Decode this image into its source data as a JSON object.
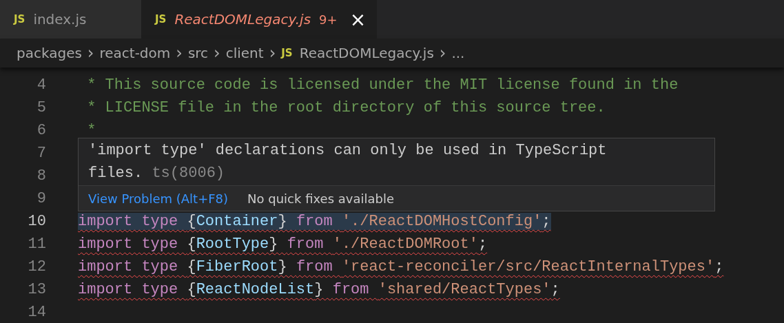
{
  "tabs": [
    {
      "icon": "JS",
      "label": "index.js",
      "selected": false
    },
    {
      "icon": "JS",
      "label": "ReactDOMLegacy.js",
      "badge": "9+",
      "close": "×",
      "selected": true
    }
  ],
  "breadcrumb": [
    {
      "label": "packages"
    },
    {
      "label": "react-dom"
    },
    {
      "label": "src"
    },
    {
      "label": "client"
    },
    {
      "icon": "JS",
      "label": "ReactDOMLegacy.js"
    },
    {
      "label": "..."
    }
  ],
  "breadcrumb_separator": "›",
  "lines": [
    {
      "number": "4",
      "tokens": [
        {
          "kind": "comment",
          "text": " * This source code is licensed under the MIT license found in the"
        }
      ]
    },
    {
      "number": "5",
      "tokens": [
        {
          "kind": "comment",
          "text": " * LICENSE file in the root directory of this source tree."
        }
      ]
    },
    {
      "number": "6",
      "tokens": [
        {
          "kind": "comment",
          "text": " *"
        }
      ]
    },
    {
      "number": "7"
    },
    {
      "number": "8"
    },
    {
      "number": "9"
    },
    {
      "number": "10",
      "highlighted": true,
      "squiggle": true,
      "tokens": [
        {
          "kind": "keyword",
          "text": "import type "
        },
        {
          "kind": "plain",
          "text": "{"
        },
        {
          "kind": "variable",
          "text": "Container"
        },
        {
          "kind": "plain",
          "text": "} "
        },
        {
          "kind": "keyword",
          "text": "from "
        },
        {
          "kind": "string",
          "text": "'./ReactDOMHostConfig'"
        },
        {
          "kind": "plain",
          "text": ";"
        }
      ]
    },
    {
      "number": "11",
      "highlighted": false,
      "squiggle": true,
      "tokens": [
        {
          "kind": "keyword",
          "text": "import type "
        },
        {
          "kind": "plain",
          "text": "{"
        },
        {
          "kind": "variable",
          "text": "RootType"
        },
        {
          "kind": "plain",
          "text": "} "
        },
        {
          "kind": "keyword",
          "text": "from "
        },
        {
          "kind": "string",
          "text": "'./ReactDOMRoot'"
        },
        {
          "kind": "plain",
          "text": ";"
        }
      ]
    },
    {
      "number": "12",
      "highlighted": false,
      "squiggle": true,
      "tokens": [
        {
          "kind": "keyword",
          "text": "import type "
        },
        {
          "kind": "plain",
          "text": "{"
        },
        {
          "kind": "variable",
          "text": "FiberRoot"
        },
        {
          "kind": "plain",
          "text": "} "
        },
        {
          "kind": "keyword",
          "text": "from "
        },
        {
          "kind": "string",
          "text": "'react-reconciler/src/ReactInternalTypes'"
        },
        {
          "kind": "plain",
          "text": ";"
        }
      ]
    },
    {
      "number": "13",
      "highlighted": false,
      "squiggle": true,
      "tokens": [
        {
          "kind": "keyword",
          "text": "import type "
        },
        {
          "kind": "plain",
          "text": "{"
        },
        {
          "kind": "variable",
          "text": "ReactNodeList"
        },
        {
          "kind": "plain",
          "text": "} "
        },
        {
          "kind": "keyword",
          "text": "from "
        },
        {
          "kind": "string",
          "text": "'shared/ReactTypes'"
        },
        {
          "kind": "plain",
          "text": ";"
        }
      ]
    },
    {
      "number": "14"
    }
  ],
  "hover": {
    "message": "'import type' declarations can only be used in TypeScript files.",
    "code": "ts(8006)",
    "action": "View Problem (Alt+F8)",
    "note": "No quick fixes available"
  }
}
